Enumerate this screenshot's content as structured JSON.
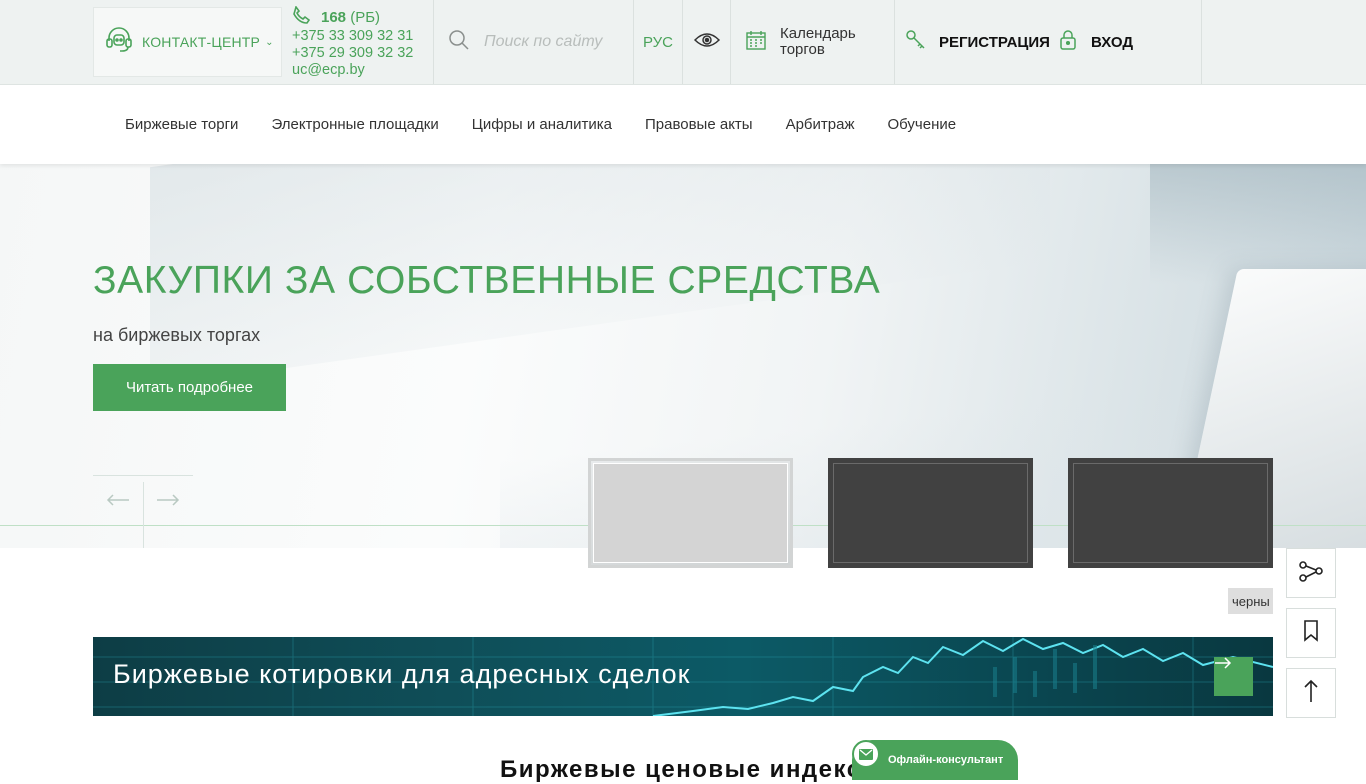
{
  "header": {
    "contact_center": "КОНТАКТ-ЦЕНТР",
    "short_phone": "168",
    "short_phone_region": "(РБ)",
    "phone1": "+375 33 309 32 31",
    "phone2": "+375 29 309 32 32",
    "email": "uc@ecp.by",
    "search_placeholder": "Поиск по сайту",
    "language": "РУС",
    "calendar_line1": "Календарь",
    "calendar_line2": "торгов",
    "register": "РЕГИСТРАЦИЯ",
    "login": "ВХОД"
  },
  "nav": {
    "items": [
      {
        "label": "Биржевые торги"
      },
      {
        "label": "Электронные площадки"
      },
      {
        "label": "Цифры и аналитика"
      },
      {
        "label": "Правовые акты"
      },
      {
        "label": "Арбитраж"
      },
      {
        "label": "Обучение"
      }
    ]
  },
  "hero": {
    "title": "ЗАКУПКИ ЗА СОБСТВЕННЫЕ СРЕДСТВА",
    "subtitle": "на биржевых торгах",
    "cta": "Читать подробнее"
  },
  "side_tools": {
    "tooltip": "черны"
  },
  "banner": {
    "title": "Биржевые котировки для адресных сделок"
  },
  "section": {
    "title": "Биржевые ценовые индексы"
  },
  "consultant": {
    "label": "Офлайн-консультант"
  },
  "colors": {
    "accent": "#4aa35a",
    "topbar_bg": "#eef2f1",
    "banner_bg": "#0c5a66"
  }
}
